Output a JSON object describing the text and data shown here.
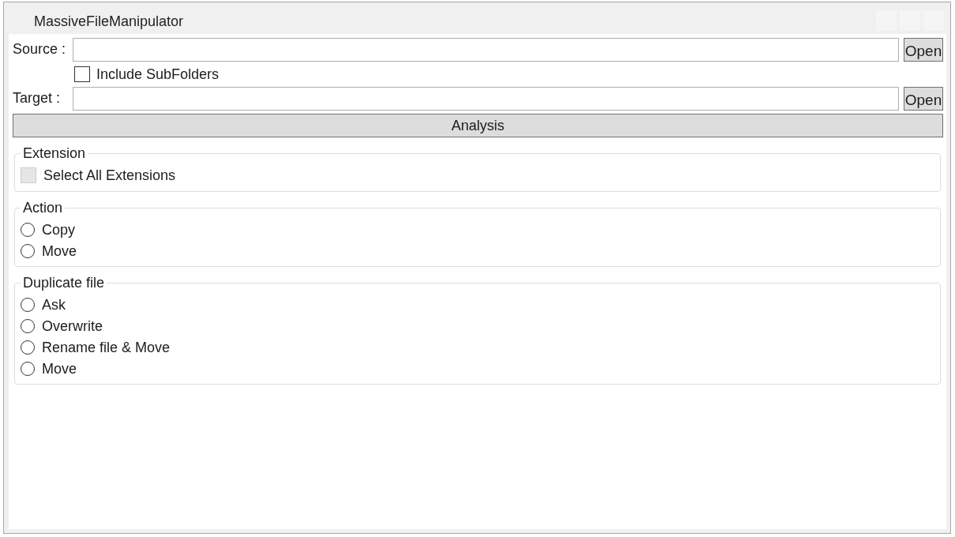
{
  "window": {
    "title": "MassiveFileManipulator"
  },
  "source": {
    "label": "Source :",
    "button": "Open"
  },
  "include_subfolders": {
    "label": "Include SubFolders",
    "checked": false
  },
  "target": {
    "label": "Target :",
    "button": "Open"
  },
  "analysis_button": "Analysis",
  "extension_group": {
    "title": "Extension",
    "select_all": {
      "label": "Select All Extensions",
      "checked": false,
      "disabled": true
    }
  },
  "action_group": {
    "title": "Action",
    "options": [
      {
        "label": "Copy",
        "selected": false
      },
      {
        "label": "Move",
        "selected": false
      }
    ]
  },
  "duplicate_group": {
    "title": "Duplicate file",
    "options": [
      {
        "label": "Ask",
        "selected": false
      },
      {
        "label": "Overwrite",
        "selected": false
      },
      {
        "label": "Rename file & Move",
        "selected": false
      },
      {
        "label": "Move",
        "selected": false
      }
    ]
  }
}
